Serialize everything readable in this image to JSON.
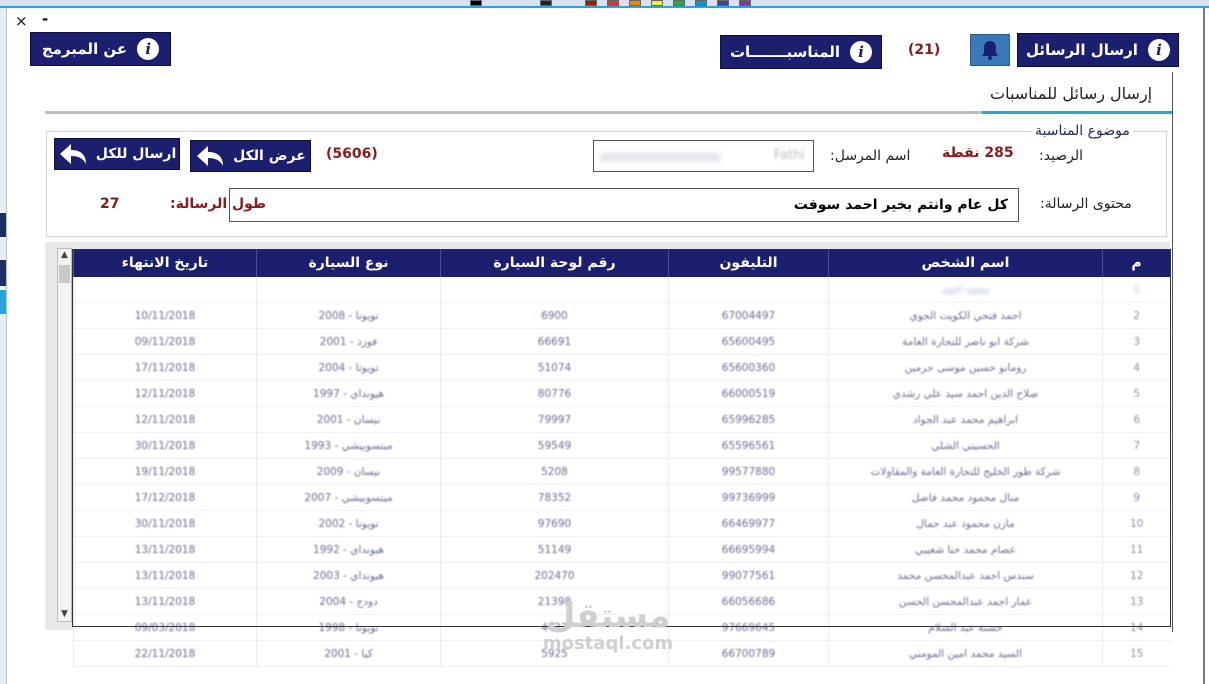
{
  "window": {
    "close_label": "×",
    "minimize_label": "-"
  },
  "nav": {
    "send_messages_label": "ارسال الرسائل",
    "occasions_label": "المناسبـــــــات",
    "occasions_count": "(21)",
    "about_label": "عن المبرمج"
  },
  "section": {
    "title": "إرسال رسائل للمناسبات"
  },
  "form": {
    "legend": "موضوع المناسبة",
    "balance_label": "الرصيد:",
    "balance_value": "285 نقطة",
    "sender_label": "اسم المرسل:",
    "sender_value": "Fathi",
    "message_label": "محتوى الرسالة:",
    "message_value": "كل عام وانتم بخير احمد سوفت",
    "length_label": "طول الرسالة:",
    "length_value": "27",
    "records_count": "(5606)",
    "show_all_label": "عرض الكل",
    "send_all_label": "ارسال للكل"
  },
  "table": {
    "columns": [
      "م",
      "اسم الشخص",
      "التليفون",
      "رقم لوحة السيارة",
      "نوع السيارة",
      "تاريخ الانتهاء"
    ],
    "rows": [
      [
        "1",
        "محمد احمد",
        "",
        "",
        "",
        ""
      ],
      [
        "2",
        "احمد فتحي الكويت الجوي",
        "67004497",
        "6900",
        "تويوتا - 2008",
        "10/11/2018"
      ],
      [
        "3",
        "شركة ابو ناصر للتجارة العامة",
        "65600495",
        "66691",
        "فورد - 2001",
        "09/11/2018"
      ],
      [
        "4",
        "رومانو حسين موسى حرمين",
        "65600360",
        "51074",
        "تويوتا - 2004",
        "17/11/2018"
      ],
      [
        "5",
        "صلاح الدين احمد سيد علي رشدي",
        "66000519",
        "80776",
        "هيونداي - 1997",
        "12/11/2018"
      ],
      [
        "6",
        "ابراهيم محمد عبد الجواد",
        "65996285",
        "79997",
        "نيسان - 2001",
        "12/11/2018"
      ],
      [
        "7",
        "الحسيني الشلي",
        "65596561",
        "59549",
        "ميتسوبيشي - 1993",
        "30/11/2018"
      ],
      [
        "8",
        "شركة طور الخليج للتجارة العامة والمقاولات",
        "99577880",
        "5208",
        "نيسان - 2009",
        "19/11/2018"
      ],
      [
        "9",
        "منال محمود محمد فاضل",
        "99736999",
        "78352",
        "ميتسوبيشي - 2007",
        "17/12/2018"
      ],
      [
        "10",
        "مازن محمود عبد جمال",
        "66469977",
        "97690",
        "تويوتا - 2002",
        "30/11/2018"
      ],
      [
        "11",
        "عصام محمد حنا شعيبي",
        "66695994",
        "51149",
        "هيونداي - 1992",
        "13/11/2018"
      ],
      [
        "12",
        "سندس احمد عبدالمحسن محمد",
        "99077561",
        "202470",
        "هيونداي - 2003",
        "13/11/2018"
      ],
      [
        "13",
        "عمار احمد عبدالمحسن الحسن",
        "66056686",
        "21398",
        "دودج - 2004",
        "13/11/2018"
      ],
      [
        "14",
        "حسنة عبد السلام",
        "97669645",
        "4427",
        "تويوتا - 1998",
        "09/03/2018"
      ],
      [
        "15",
        "السيد محمد امين المومني",
        "66700789",
        "5925",
        "كيا - 2001",
        "22/11/2018"
      ]
    ]
  },
  "watermark": {
    "arabic": "مستقل",
    "latin": "mostaql.com"
  },
  "colors": {
    "navy": "#1b1f6e",
    "accent_blue": "#2aa4d6",
    "red_text": "#8b1a1a",
    "bell_blue": "#3a78b8"
  },
  "icons": [
    "info-icon",
    "bell-icon",
    "back-arrow-icon"
  ]
}
